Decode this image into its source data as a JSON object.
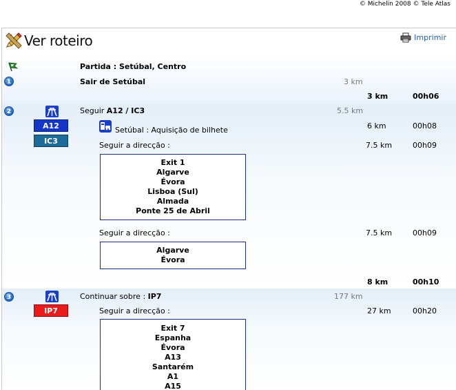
{
  "copyright": "© Michelin 2008 © Tele Atlas",
  "header": {
    "title": "Ver roteiro",
    "print_label": "Imprimir"
  },
  "colors": {
    "link": "#1f5fb0",
    "road_blue": "#1437c8",
    "road_teal": "#1d6b98",
    "road_red": "#ea1b1b",
    "badge": "#2c74cf"
  },
  "route": {
    "start": {
      "prefix": "Partida : ",
      "place": "Setúbal, Centro"
    },
    "step1": {
      "number": "1",
      "text": "Sair de Setúbal",
      "distance": "3 km",
      "total_distance": "3 km",
      "total_time": "00h06"
    },
    "step2": {
      "number": "2",
      "prefix": "Seguir ",
      "roads_text": "A12 / IC3",
      "distance": "5.5 km",
      "road1": "A12",
      "road2": "IC3",
      "toll": {
        "place": "Setúbal",
        "text": " : Aquisição de bilhete",
        "distance": "6 km",
        "time": "00h08"
      },
      "follow1": {
        "label": "Seguir a direcção :",
        "distance": "7.5 km",
        "time": "00h09",
        "lines": [
          "Exit 1",
          "Algarve",
          "Évora",
          "Lisboa (Sul)",
          "Almada",
          "Ponte 25 de Abril"
        ]
      },
      "follow2": {
        "label": "Seguir a direcção :",
        "distance": "7.5 km",
        "time": "00h09",
        "lines": [
          "Algarve",
          "Évora"
        ]
      },
      "total_distance": "8 km",
      "total_time": "00h10"
    },
    "step3": {
      "number": "3",
      "prefix": "Continuar sobre : ",
      "road_text": "IP7",
      "distance": "177 km",
      "road1": "IP7",
      "follow1": {
        "label": "Seguir a direcção :",
        "distance": "27 km",
        "time": "00h20",
        "lines": [
          "Exit 7",
          "Espanha",
          "Évora",
          "A13",
          "Santarém",
          "A1",
          "A15"
        ]
      }
    }
  }
}
